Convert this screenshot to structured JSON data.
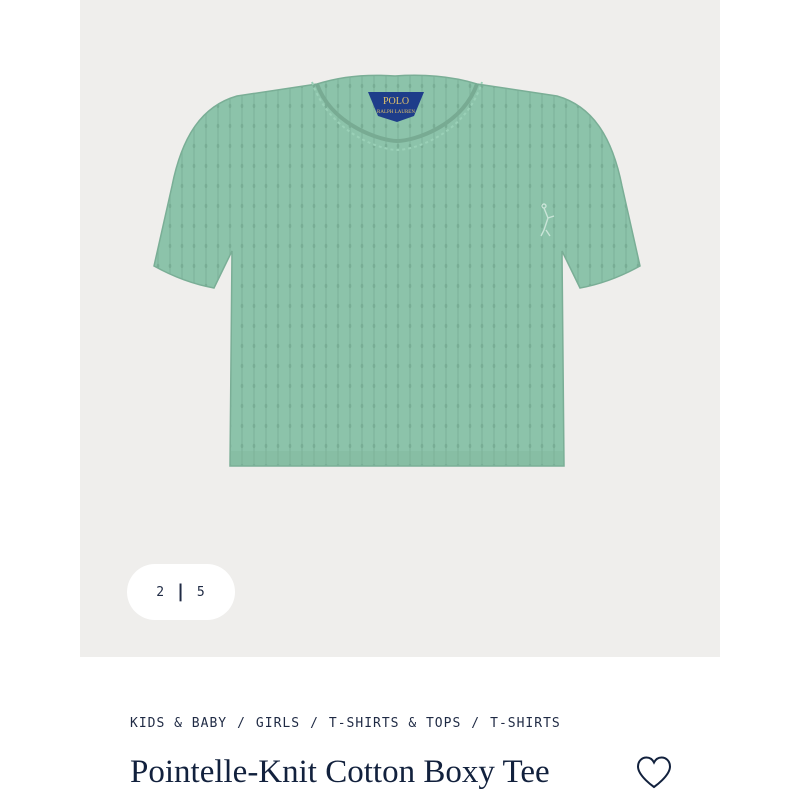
{
  "gallery": {
    "current": "2",
    "separator": "|",
    "total": "5",
    "label_brand_top": "POLO",
    "label_brand_bottom": "RALPH LAUREN",
    "shirt_color": "#8cc3aa",
    "background_color": "#efeeec"
  },
  "breadcrumb": {
    "items": [
      "KIDS & BABY",
      "GIRLS",
      "T-SHIRTS & TOPS",
      "T-SHIRTS"
    ],
    "separator": "/"
  },
  "product": {
    "title": "Pointelle-Knit Cotton Boxy Tee"
  },
  "icons": {
    "wishlist": "heart-outline-icon"
  }
}
